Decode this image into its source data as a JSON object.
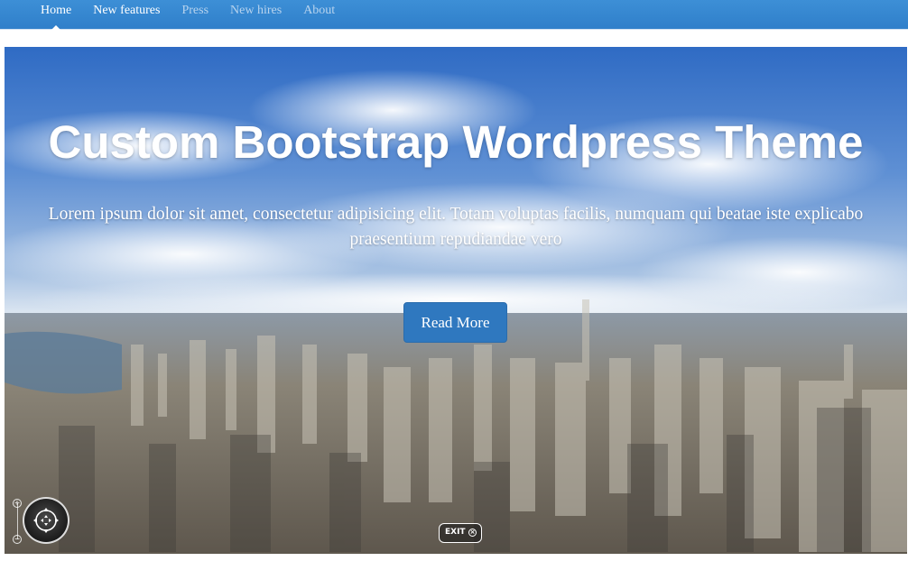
{
  "navbar": {
    "items": [
      {
        "label": "Home",
        "active": true
      },
      {
        "label": "New features",
        "active": false
      },
      {
        "label": "Press",
        "active": false
      },
      {
        "label": "New hires",
        "active": false
      },
      {
        "label": "About",
        "active": false
      }
    ],
    "color": "#3385d0"
  },
  "hero": {
    "title": "Custom Bootstrap Wordpress Theme",
    "text": "Lorem ipsum dolor sit amet, consectetur adipisicing elit. Totam voluptas facilis, numquam qui beatae iste explicabo praesentium repudiandae vero",
    "button_label": "Read More",
    "button_color": "#2f78bf",
    "background": "aerial-city-panorama"
  },
  "panorama_controls": {
    "zoom_in_icon": "plus-icon",
    "zoom_out_icon": "minus-icon",
    "navigation_icon": "move-arrows-icon",
    "exit_label": "EXIT",
    "exit_icon": "close-circle-icon"
  }
}
